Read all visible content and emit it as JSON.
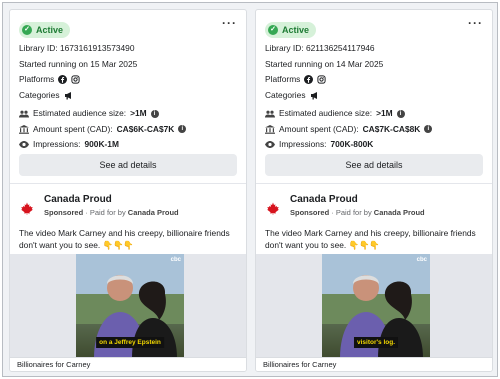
{
  "cards": [
    {
      "status": "Active",
      "library_id": "Library ID: 1673161913573490",
      "started": "Started running on 15 Mar 2025",
      "platforms_label": "Platforms",
      "categories_label": "Categories",
      "audience_label": "Estimated audience size:",
      "audience_value": ">1M",
      "amount_label": "Amount spent (CAD):",
      "amount_value": "CA$6K-CA$7K",
      "impressions_label": "Impressions:",
      "impressions_value": "900K-1M",
      "details_button": "See ad details",
      "advertiser": "Canada Proud",
      "sponsored": "Sponsored",
      "paid_for_prefix": "· Paid for by",
      "paid_for": "Canada Proud",
      "ad_text": "The video Mark Carney and his creepy, billionaire friends don't want you to see. 👇👇👇",
      "video_caption": "on a Jeffrey Epstein",
      "video_watermark": "cbc",
      "footer": "Billionaires for Carney"
    },
    {
      "status": "Active",
      "library_id": "Library ID: 621136254117946",
      "started": "Started running on 14 Mar 2025",
      "platforms_label": "Platforms",
      "categories_label": "Categories",
      "audience_label": "Estimated audience size:",
      "audience_value": ">1M",
      "amount_label": "Amount spent (CAD):",
      "amount_value": "CA$7K-CA$8K",
      "impressions_label": "Impressions:",
      "impressions_value": "700K-800K",
      "details_button": "See ad details",
      "advertiser": "Canada Proud",
      "sponsored": "Sponsored",
      "paid_for_prefix": "· Paid for by",
      "paid_for": "Canada Proud",
      "ad_text": "The video Mark Carney and his creepy, billionaire friends don't want you to see. 👇👇👇",
      "video_caption": "visitor's log.",
      "video_watermark": "cbc",
      "footer": "Billionaires for Carney"
    }
  ],
  "icons": {
    "more": "more-options-icon",
    "facebook": "facebook-icon",
    "instagram": "instagram-icon",
    "megaphone": "megaphone-icon",
    "people": "people-icon",
    "bank": "bank-icon",
    "eye": "eye-icon",
    "info": "info-icon"
  },
  "colors": {
    "active_bg": "#d6f1d9",
    "active_text": "#1e7b34",
    "button_bg": "#e9ebee",
    "logo_red": "#d7141e"
  }
}
